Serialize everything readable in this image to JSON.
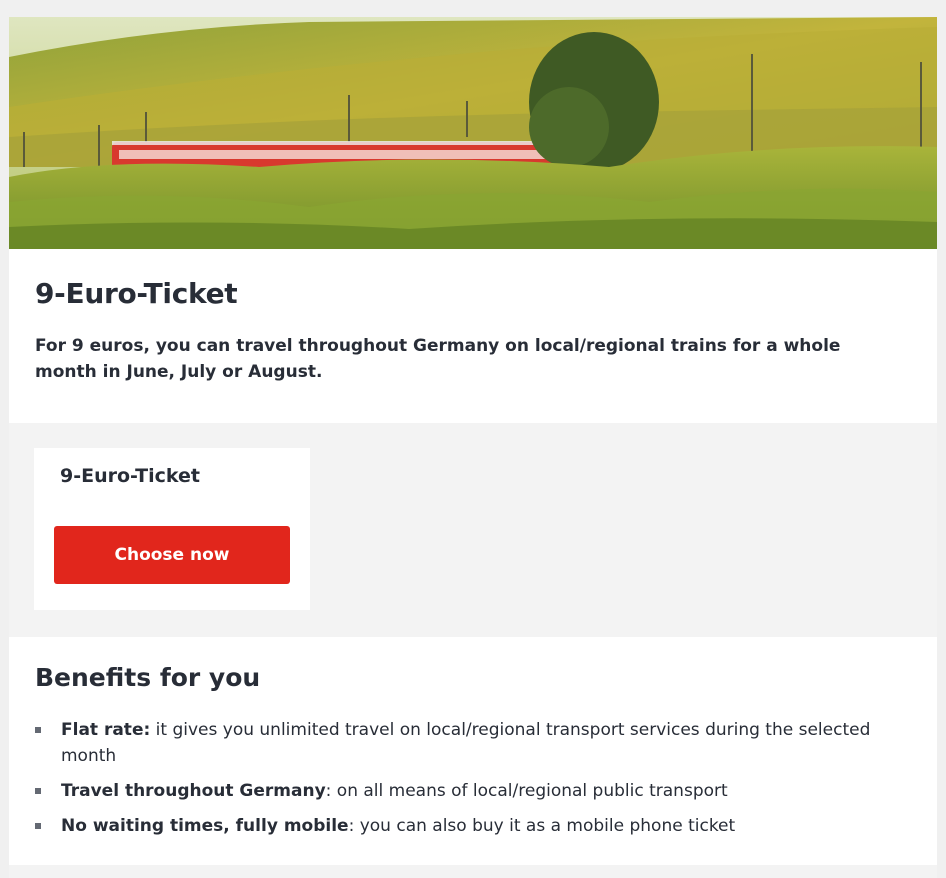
{
  "hero": {
    "image_subject": "red regional train passing through vineyards"
  },
  "intro": {
    "title": "9-Euro-Ticket",
    "description": "For 9 euros, you can travel throughout Germany on local/regional trains for a whole month in June, July or August."
  },
  "offer": {
    "card_title": "9-Euro-Ticket",
    "button_label": "Choose now"
  },
  "benefits": {
    "heading": "Benefits for you",
    "items": [
      {
        "strong": "Flat rate:",
        "text": " it gives you unlimited travel on local/regional transport services during the selected month"
      },
      {
        "strong": "Travel throughout Germany",
        "text": ": on all means of local/regional public transport"
      },
      {
        "strong": "No waiting times, fully mobile",
        "text": ": you can also buy it as a mobile phone ticket"
      }
    ]
  },
  "colors": {
    "brand_red": "#e1261c",
    "text_dark": "#282d37",
    "band_gray": "#f3f3f3",
    "bullet_gray": "#646973"
  }
}
